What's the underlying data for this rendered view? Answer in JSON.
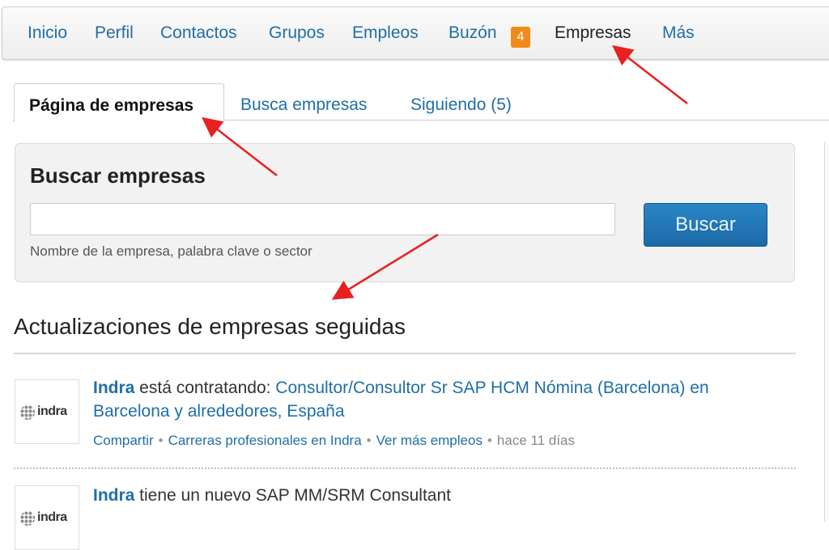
{
  "nav": {
    "items": [
      "Inicio",
      "Perfil",
      "Contactos",
      "Grupos",
      "Empleos",
      "Buzón",
      "Empresas",
      "Más"
    ],
    "inbox_badge": "4",
    "active": "Empresas"
  },
  "tabs": {
    "items": [
      "Página de empresas",
      "Busca empresas",
      "Siguiendo (5)"
    ],
    "active": "Página de empresas"
  },
  "search": {
    "title": "Buscar empresas",
    "value": "",
    "placeholder": "",
    "help": "Nombre de la empresa, palabra clave o sector",
    "button": "Buscar"
  },
  "updates": {
    "title": "Actualizaciones de empresas seguidas",
    "items": [
      {
        "logo": "indra",
        "company": "Indra",
        "verb": " está contratando: ",
        "job": "Consultor/Consultor Sr SAP HCM Nómina (Barcelona) en",
        "job_cont": "Barcelona y alrededores, España",
        "actions": [
          "Compartir",
          "Carreras profesionales en Indra",
          "Ver más empleos"
        ],
        "time": "hace 11 días"
      },
      {
        "logo": "indra",
        "company": "Indra",
        "text": " tiene un nuevo SAP MM/SRM Consultant"
      }
    ]
  },
  "colors": {
    "link": "#1f6ea7",
    "badge": "#f08b1b",
    "button": "#1c6aa6",
    "annotation_arrow": "#e8201f"
  }
}
